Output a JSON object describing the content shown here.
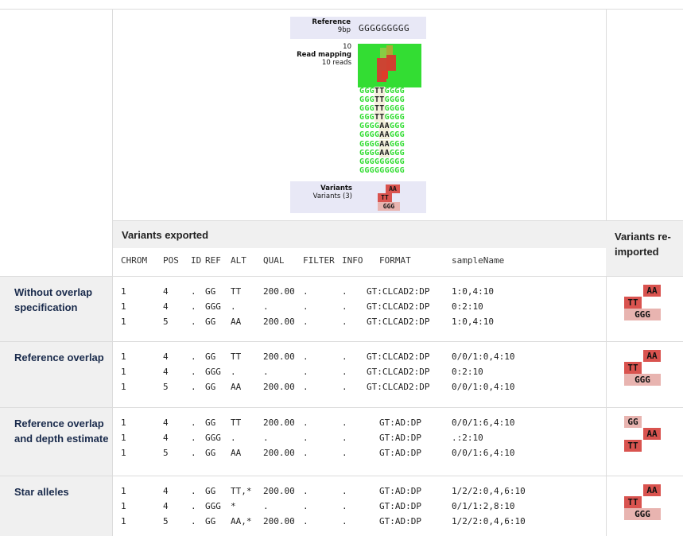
{
  "reference": {
    "title": "Reference",
    "length": "9bp",
    "sequence": "GGGGGGGGG"
  },
  "read_mapping": {
    "count_top": "10",
    "title": "Read mapping",
    "reads_label": "10 reads",
    "reads": [
      [
        "GGG",
        "TT",
        "GGGG"
      ],
      [
        "GGG",
        "TT",
        "GGGG"
      ],
      [
        "GGG",
        "TT",
        "GGGG"
      ],
      [
        "GGG",
        "TT",
        "GGGG"
      ],
      [
        "GGGG",
        "AA",
        "GGG"
      ],
      [
        "GGGG",
        "AA",
        "GGG"
      ],
      [
        "GGGG",
        "AA",
        "GGG"
      ],
      [
        "GGGG",
        "AA",
        "GGG"
      ],
      [
        "GGGGGGGGG",
        "",
        ""
      ],
      [
        "GGGGGGGGG",
        "",
        ""
      ]
    ]
  },
  "variants_track": {
    "title": "Variants",
    "subtitle": "Variants (3)",
    "glyphs": [
      "AA",
      "TT",
      "GGG"
    ]
  },
  "headers": {
    "variants_exported": "Variants exported",
    "variants_reimported": "Variants re-imported",
    "columns": [
      "CHROM",
      "POS",
      "ID",
      "REF",
      "ALT",
      "QUAL",
      "FILTER",
      "INFO",
      "FORMAT",
      "sampleName"
    ]
  },
  "rows": [
    {
      "label": "Without overlap specification",
      "lines": [
        [
          "1",
          "4",
          ".",
          "GG",
          "TT",
          "200.00",
          ".",
          ".",
          "GT:CLCAD2:DP",
          "1:0,4:10"
        ],
        [
          "1",
          "4",
          ".",
          "GGG",
          ".",
          ".",
          ".",
          ".",
          "GT:CLCAD2:DP",
          "0:2:10"
        ],
        [
          "1",
          "5",
          ".",
          "GG",
          "AA",
          "200.00",
          ".",
          ".",
          "GT:CLCAD2:DP",
          "1:0,4:10"
        ]
      ],
      "reimported": [
        "AA",
        "TT",
        "GGG"
      ]
    },
    {
      "label": "Reference overlap",
      "lines": [
        [
          "1",
          "4",
          ".",
          "GG",
          "TT",
          "200.00",
          ".",
          ".",
          "GT:CLCAD2:DP",
          "0/0/1:0,4:10"
        ],
        [
          "1",
          "4",
          ".",
          "GGG",
          ".",
          ".",
          ".",
          ".",
          "GT:CLCAD2:DP",
          "0:2:10"
        ],
        [
          "1",
          "5",
          ".",
          "GG",
          "AA",
          "200.00",
          ".",
          ".",
          "GT:CLCAD2:DP",
          "0/0/1:0,4:10"
        ]
      ],
      "reimported": [
        "AA",
        "TT",
        "GGG"
      ]
    },
    {
      "label": "Reference overlap and depth estimate",
      "lines": [
        [
          "1",
          "4",
          ".",
          "GG",
          "TT",
          "200.00",
          ".",
          ".",
          "GT:AD:DP",
          "0/0/1:6,4:10"
        ],
        [
          "1",
          "4",
          ".",
          "GGG",
          ".",
          ".",
          ".",
          ".",
          "GT:AD:DP",
          ".:2:10"
        ],
        [
          "1",
          "5",
          ".",
          "GG",
          "AA",
          "200.00",
          ".",
          ".",
          "GT:AD:DP",
          "0/0/1:6,4:10"
        ]
      ],
      "reimported": [
        "GG",
        "AA",
        "TT"
      ]
    },
    {
      "label": "Star alleles",
      "lines": [
        [
          "1",
          "4",
          ".",
          "GG",
          "TT,*",
          "200.00",
          ".",
          ".",
          "GT:AD:DP",
          "1/2/2:0,4,6:10"
        ],
        [
          "1",
          "4",
          ".",
          "GGG",
          "*",
          ".",
          ".",
          ".",
          "GT:AD:DP",
          "0/1/1:2,8:10"
        ],
        [
          "1",
          "5",
          ".",
          "GG",
          "AA,*",
          "200.00",
          ".",
          ".",
          "GT:AD:DP",
          "1/2/2:0,4,6:10"
        ]
      ],
      "reimported": [
        "AA",
        "TT",
        "GGG"
      ]
    }
  ],
  "colors": {
    "read_green": "#33dd33",
    "variant_alt": "#d9534f",
    "variant_ref": "#e8b4b0",
    "panel_bg": "#e8e8f6",
    "header_bg": "#f0f0f0"
  }
}
